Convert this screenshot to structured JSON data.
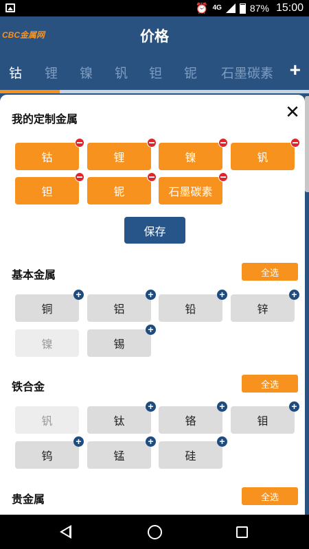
{
  "status_bar": {
    "network": "4G",
    "battery": "87%",
    "time": "15:00"
  },
  "header": {
    "logo": "CBC金属网",
    "title": "价格"
  },
  "tabs": {
    "items": [
      {
        "label": "钴",
        "active": true
      },
      {
        "label": "锂",
        "active": false
      },
      {
        "label": "镍",
        "active": false
      },
      {
        "label": "钒",
        "active": false
      },
      {
        "label": "钽",
        "active": false
      },
      {
        "label": "铌",
        "active": false
      },
      {
        "label": "石墨碳素",
        "active": false
      }
    ],
    "add": "+"
  },
  "custom": {
    "title": "我的定制金属",
    "items": [
      "钴",
      "锂",
      "镍",
      "钒",
      "钽",
      "铌",
      "石墨碳素"
    ],
    "save": "保存",
    "close": "✕"
  },
  "basic": {
    "title": "基本金属",
    "select_all": "全选",
    "items": [
      {
        "label": "铜",
        "added": false
      },
      {
        "label": "铝",
        "added": false
      },
      {
        "label": "铅",
        "added": false
      },
      {
        "label": "锌",
        "added": false
      },
      {
        "label": "镍",
        "added": true
      },
      {
        "label": "锡",
        "added": false
      }
    ]
  },
  "ferro": {
    "title": "铁合金",
    "select_all": "全选",
    "items": [
      {
        "label": "钒",
        "added": true
      },
      {
        "label": "钛",
        "added": false
      },
      {
        "label": "铬",
        "added": false
      },
      {
        "label": "钼",
        "added": false
      },
      {
        "label": "钨",
        "added": false
      },
      {
        "label": "锰",
        "added": false
      },
      {
        "label": "硅",
        "added": false
      }
    ]
  },
  "precious": {
    "title": "贵金属",
    "select_all": "全选"
  },
  "colors": {
    "brand_blue": "#2a5281",
    "accent_orange": "#f7921e",
    "remove_red": "#e0242a",
    "add_blue": "#1f4c80"
  }
}
